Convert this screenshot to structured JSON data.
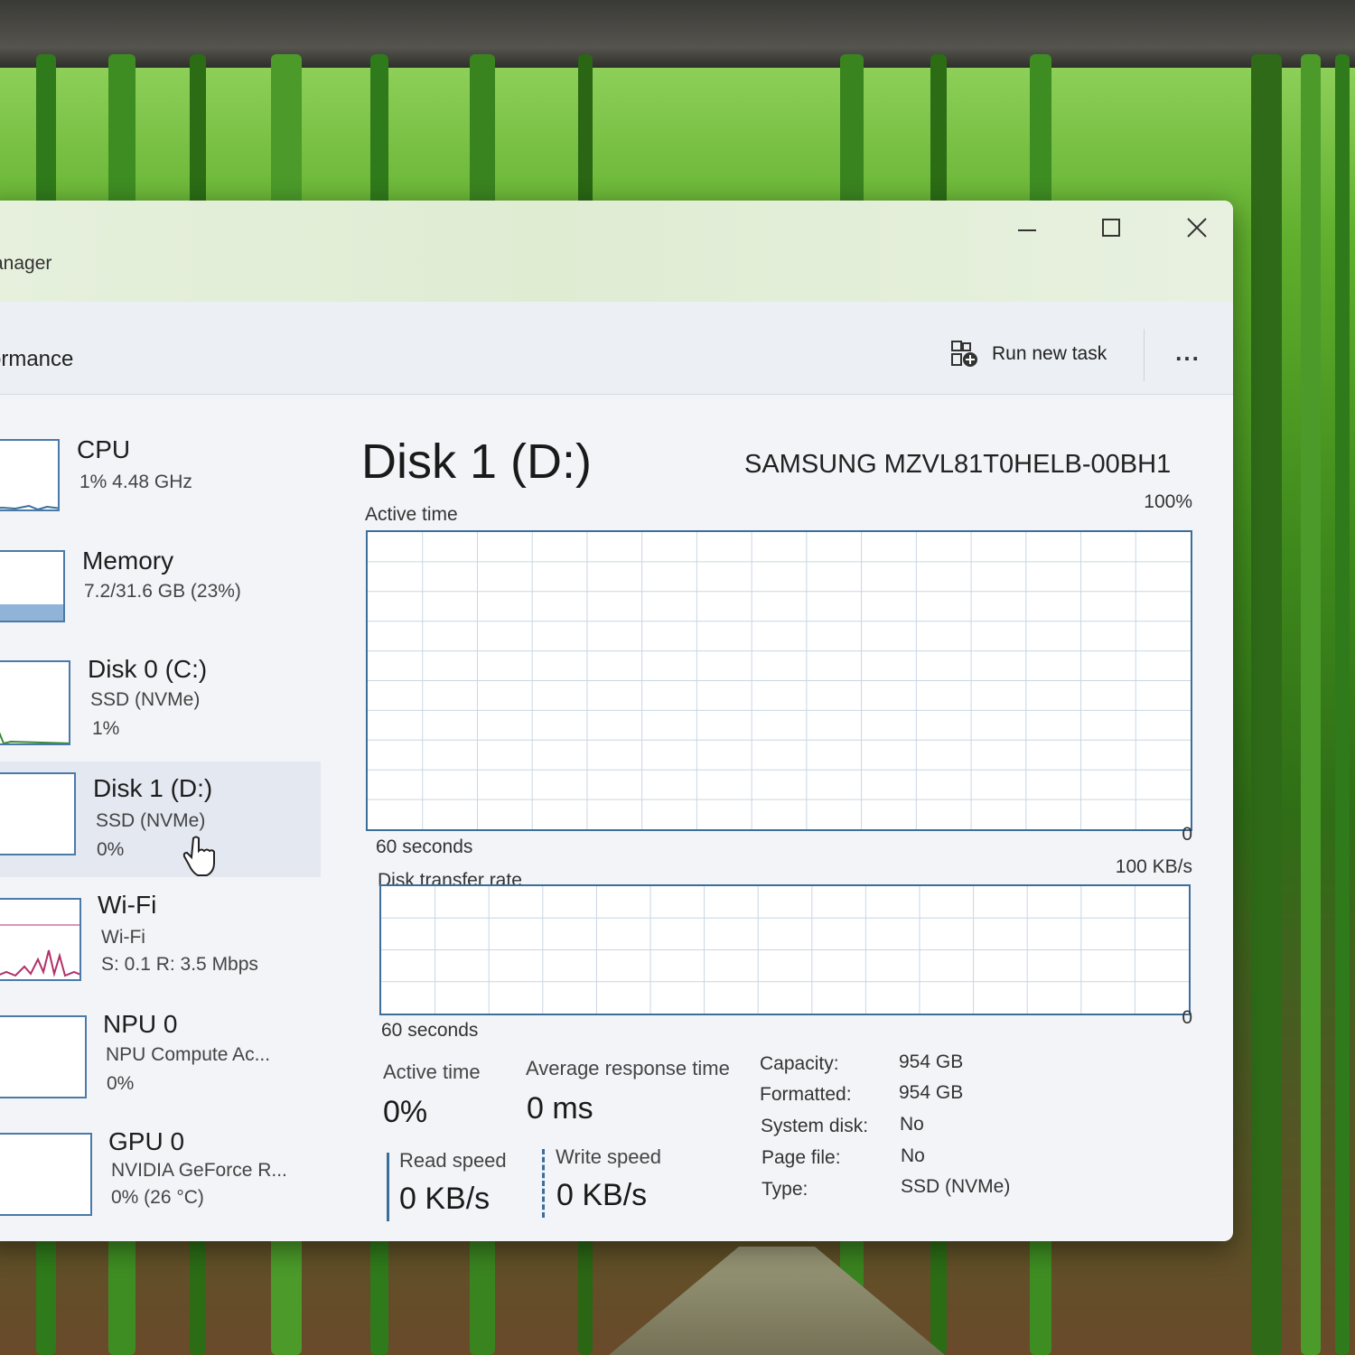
{
  "window": {
    "title": "anager",
    "controls": {
      "minimize": "minimize",
      "maximize": "maximize",
      "close": "close"
    }
  },
  "header": {
    "page_title": "ormance",
    "run_new_task": "Run new task",
    "more_label": "..."
  },
  "sidebar": {
    "items": [
      {
        "title": "CPU",
        "lines": [
          "1% 4.48 GHz"
        ]
      },
      {
        "title": "Memory",
        "lines": [
          "7.2/31.6 GB (23%)"
        ]
      },
      {
        "title": "Disk 0 (C:)",
        "lines": [
          "SSD (NVMe)",
          "1%"
        ]
      },
      {
        "title": "Disk 1 (D:)",
        "lines": [
          "SSD (NVMe)",
          "0%"
        ],
        "selected": true
      },
      {
        "title": "Wi-Fi",
        "lines": [
          "Wi-Fi",
          "S: 0.1 R: 3.5 Mbps"
        ]
      },
      {
        "title": "NPU 0",
        "lines": [
          "NPU Compute Ac...",
          "0%"
        ]
      },
      {
        "title": "GPU 0",
        "lines": [
          "NVIDIA GeForce R...",
          "0% (26 °C)"
        ]
      }
    ]
  },
  "main": {
    "title": "Disk 1 (D:)",
    "model": "SAMSUNG MZVL81T0HELB-00BH1",
    "active_chart": {
      "label": "Active time",
      "max": "100%",
      "min": "0",
      "duration": "60 seconds"
    },
    "transfer_chart": {
      "label": "Disk transfer rate",
      "max": "100 KB/s",
      "min": "0",
      "duration": "60 seconds"
    },
    "stats": {
      "active_time_label": "Active time",
      "active_time_value": "0%",
      "avg_response_label": "Average response time",
      "avg_response_value": "0 ms",
      "read_label": "Read speed",
      "read_value": "0 KB/s",
      "write_label": "Write speed",
      "write_value": "0 KB/s"
    },
    "properties": [
      {
        "key": "Capacity:",
        "value": "954 GB"
      },
      {
        "key": "Formatted:",
        "value": "954 GB"
      },
      {
        "key": "System disk:",
        "value": "No"
      },
      {
        "key": "Page file:",
        "value": "No"
      },
      {
        "key": "Type:",
        "value": "SSD (NVMe)"
      }
    ]
  },
  "colors": {
    "graph_border": "#3c6e9a",
    "wifi_graph": "#b0306a",
    "memory_fill": "#8fb4d8"
  },
  "icons": [
    "run-task-icon",
    "more-icon",
    "minimize-icon",
    "maximize-icon",
    "close-icon",
    "hand-cursor-icon"
  ]
}
